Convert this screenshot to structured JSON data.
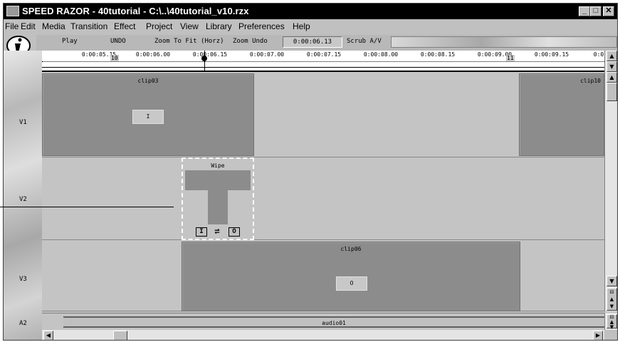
{
  "window": {
    "title": "SPEED RAZOR - 40tutorial - C:\\..\\40tutorial_v10.rzx",
    "controls": {
      "minimize": "_",
      "maximize": "□",
      "close": "✕"
    }
  },
  "menu": [
    "File",
    "Edit",
    "Media",
    "Transition",
    "Effect",
    "Project",
    "View",
    "Library",
    "Preferences",
    "Help"
  ],
  "toolbar": {
    "play": "Play",
    "undo": "UNDO",
    "zoom_to_fit": "Zoom To Fit (Horz)",
    "zoom_undo": "Zoom Undo",
    "timecode": "0:00:06.13",
    "scrub": "Scrub A/V"
  },
  "ruler": {
    "ticks": [
      "0:00:05.15",
      "0:00:06.00",
      "0:00:06.15",
      "0:00:07.00",
      "0:00:07.15",
      "0:00:08.00",
      "0:00:08.15",
      "0:00:09.00",
      "0:00:09.15",
      "0:0"
    ],
    "markers": [
      "10",
      "11"
    ]
  },
  "tracks": {
    "v1": {
      "label": "V1",
      "clips": [
        {
          "name": "clip03",
          "tag": "I"
        },
        {
          "name": "clip10"
        }
      ]
    },
    "v2": {
      "label": "V2",
      "transition": {
        "name": "Wipe",
        "in": "I",
        "swap": "⇌",
        "out": "O"
      }
    },
    "v3": {
      "label": "V3",
      "clips": [
        {
          "name": "clip06",
          "tag": "O"
        }
      ]
    },
    "a2": {
      "label": "A2",
      "clips": [
        {
          "name": "audio01"
        }
      ]
    }
  },
  "icons": {
    "logo": "info-i-logo",
    "scroll_up": "▲",
    "scroll_down": "▼",
    "scroll_left": "◀",
    "scroll_right": "▶"
  }
}
